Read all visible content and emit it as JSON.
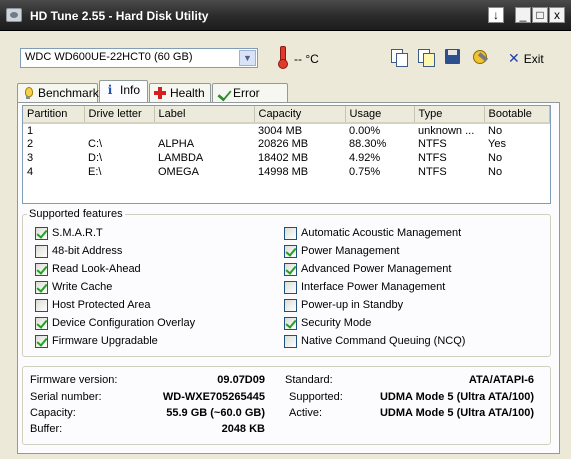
{
  "window": {
    "title": "HD Tune 2.55 - Hard Disk Utility",
    "arrow_button": "↓",
    "min_button": "_",
    "max_button": "□",
    "close_button": "x"
  },
  "toolbar": {
    "drive_selected": "WDC WD600UE-22HCT0 (60 GB)",
    "temperature": "-- °C",
    "exit_label": "Exit",
    "icons": [
      "thermometer-icon",
      "copy-icon",
      "copy-all-icon",
      "save-icon",
      "options-icon",
      "exit-icon"
    ]
  },
  "tabs": [
    {
      "label": "Benchmark",
      "icon": "benchmark-icon"
    },
    {
      "label": "Info",
      "icon": "info-icon",
      "active": true
    },
    {
      "label": "Health",
      "icon": "health-icon"
    },
    {
      "label": "Error Scan",
      "icon": "error-scan-icon"
    }
  ],
  "partitions": {
    "headers": [
      "Partition",
      "Drive letter",
      "Label",
      "Capacity",
      "Usage",
      "Type",
      "Bootable"
    ],
    "rows": [
      [
        "1",
        "",
        "",
        "3004 MB",
        "0.00%",
        "unknown ...",
        "No"
      ],
      [
        "2",
        "C:\\",
        "ALPHA",
        "20826 MB",
        "88.30%",
        "NTFS",
        "Yes"
      ],
      [
        "3",
        "D:\\",
        "LAMBDA",
        "18402 MB",
        "4.92%",
        "NTFS",
        "No"
      ],
      [
        "4",
        "E:\\",
        "OMEGA",
        "14998 MB",
        "0.75%",
        "NTFS",
        "No"
      ]
    ]
  },
  "features": {
    "title": "Supported features",
    "left": [
      {
        "label": "S.M.A.R.T",
        "checked": true
      },
      {
        "label": "48-bit Address",
        "checked": false
      },
      {
        "label": "Read Look-Ahead",
        "checked": true
      },
      {
        "label": "Write Cache",
        "checked": true
      },
      {
        "label": "Host Protected Area",
        "checked": false
      },
      {
        "label": "Device Configuration Overlay",
        "checked": true
      },
      {
        "label": "Firmware Upgradable",
        "checked": true
      }
    ],
    "right": [
      {
        "label": "Automatic Acoustic Management",
        "checked": false
      },
      {
        "label": "Power Management",
        "checked": true
      },
      {
        "label": "Advanced Power Management",
        "checked": true
      },
      {
        "label": "Interface Power Management",
        "checked": false
      },
      {
        "label": "Power-up in Standby",
        "checked": false
      },
      {
        "label": "Security Mode",
        "checked": true
      },
      {
        "label": "Native Command Queuing (NCQ)",
        "checked": false
      }
    ]
  },
  "details": {
    "firmware_label": "Firmware version:",
    "firmware_value": "09.07D09",
    "serial_label": "Serial number:",
    "serial_value": "WD-WXE705265445",
    "capacity_label": "Capacity:",
    "capacity_value": "55.9 GB (~60.0 GB)",
    "buffer_label": "Buffer:",
    "buffer_value": "2048 KB",
    "standard_label": "Standard:",
    "standard_value": "ATA/ATAPI-6",
    "supported_label": "Supported:",
    "supported_value": "UDMA Mode 5 (Ultra ATA/100)",
    "active_label": "Active:",
    "active_value": "UDMA Mode 5 (Ultra ATA/100)"
  }
}
